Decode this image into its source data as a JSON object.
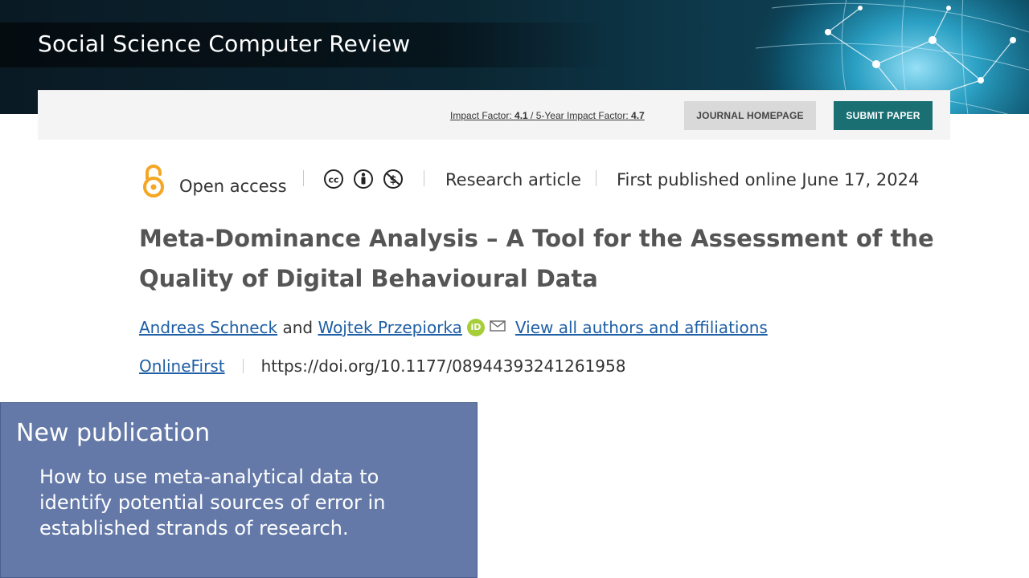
{
  "banner": {
    "journal_title": "Social Science Computer Review"
  },
  "toolbar": {
    "impact_factor_label": "Impact Factor:",
    "impact_factor_value": "4.1",
    "impact_divider": " / ",
    "five_year_label": "5-Year Impact Factor:",
    "five_year_value": "4.7",
    "journal_homepage_label": "JOURNAL HOMEPAGE",
    "submit_paper_label": "SUBMIT PAPER"
  },
  "article": {
    "access_label": "Open access",
    "license_icons": [
      "cc-icon",
      "by-icon",
      "nc-icon"
    ],
    "type_label": "Research article",
    "published_label": "First published online June 17, 2024",
    "title": "Meta-Dominance Analysis – A Tool for the Assessment of the Quality of Digital Behavioural Data",
    "authors": {
      "author_1": "Andreas Schneck",
      "conjunction": "and",
      "author_2": "Wojtek Przepiorka",
      "orcid_badge": "iD",
      "affiliations_link": "View all authors and affiliations"
    },
    "status_label": "OnlineFirst",
    "doi": "https://doi.org/10.1177/08944393241261958"
  },
  "highlight": {
    "heading": "New publication",
    "body": "How to use meta-analytical data to identify potential sources of error in established strands of research."
  },
  "colors": {
    "banner_dark": "#0b2633",
    "submit_button": "#1a6f73",
    "open_access_orange": "#f5a623",
    "link_blue": "#1f5fa5",
    "highlight_box": "#6479a8",
    "orcid_green": "#a6ce39"
  }
}
